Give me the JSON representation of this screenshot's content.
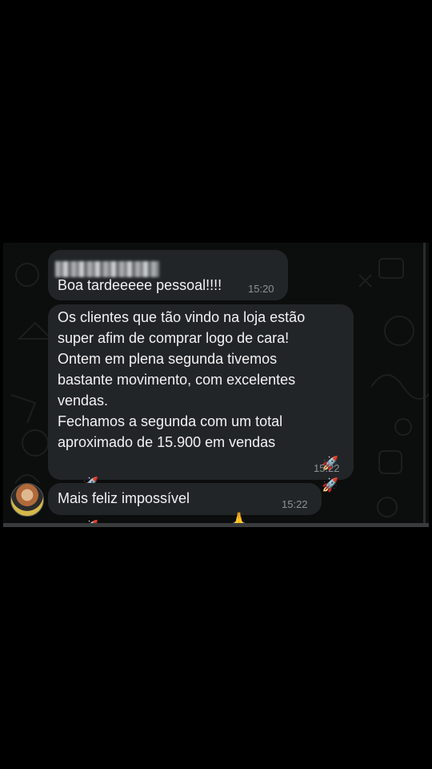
{
  "messages": [
    {
      "sender": "",
      "text": "Boa tardeeeee pessoal!!!!",
      "time": "15:20"
    },
    {
      "lines": [
        "Os clientes que tão vindo na loja estão",
        "super afim de comprar logo de cara!",
        "Ontem em plena segunda tivemos",
        "bastante movimento, com excelentes",
        "vendas.",
        "Fechamos a segunda com um total",
        "aproximado de 15.900 em vendas"
      ],
      "time": "15:22"
    },
    {
      "text": "Mais feliz impossível",
      "time": "15:22"
    }
  ],
  "emojis": {
    "rocket": "🚀",
    "pray": "🙏",
    "party_face": "🥳"
  },
  "colors": {
    "bubble": "#222528",
    "background": "#0c0d0d",
    "time": "#8c9196"
  }
}
